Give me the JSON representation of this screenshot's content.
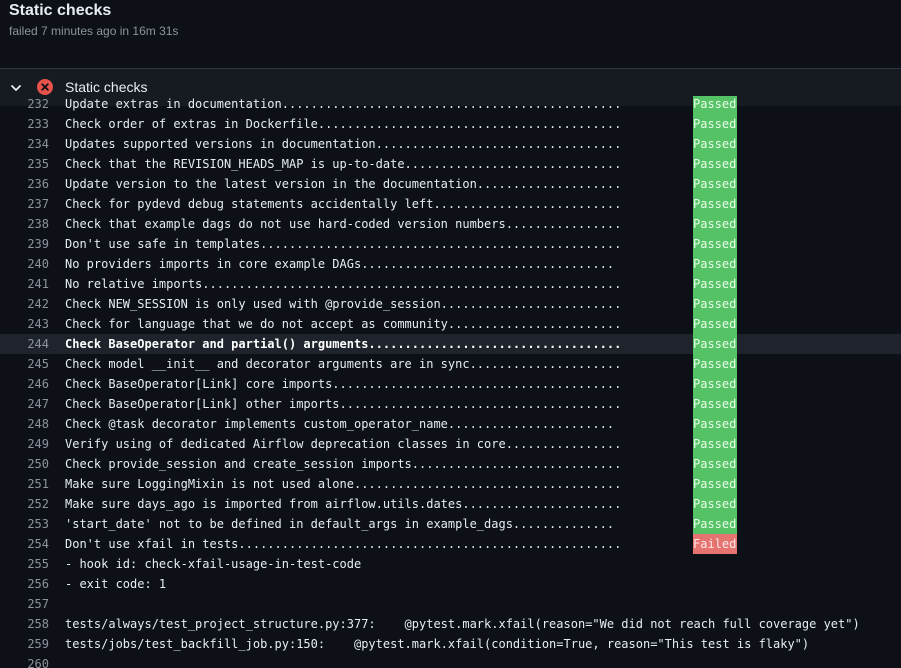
{
  "header": {
    "title": "Static checks",
    "subtitle": "failed 7 minutes ago in 16m 31s"
  },
  "step": {
    "title": "Static checks",
    "state_icon": "x-circle-icon",
    "toggle_icon": "chevron-down-icon",
    "status_color": "#e5534b"
  },
  "colors": {
    "passed": "#56c266",
    "failed": "#e5736f"
  },
  "log": [
    {
      "n": "232",
      "text": "Update extras in documentation...............................................",
      "status": "Passed"
    },
    {
      "n": "233",
      "text": "Check order of extras in Dockerfile..........................................",
      "status": "Passed"
    },
    {
      "n": "234",
      "text": "Updates supported versions in documentation..................................",
      "status": "Passed"
    },
    {
      "n": "235",
      "text": "Check that the REVISION_HEADS_MAP is up-to-date..............................",
      "status": "Passed"
    },
    {
      "n": "236",
      "text": "Update version to the latest version in the documentation....................",
      "status": "Passed"
    },
    {
      "n": "237",
      "text": "Check for pydevd debug statements accidentally left..........................",
      "status": "Passed"
    },
    {
      "n": "238",
      "text": "Check that example dags do not use hard-coded version numbers................",
      "status": "Passed"
    },
    {
      "n": "239",
      "text": "Don't use safe in templates..................................................",
      "status": "Passed"
    },
    {
      "n": "240",
      "text": "No providers imports in core example DAGs...................................",
      "status": "Passed"
    },
    {
      "n": "241",
      "text": "No relative imports..........................................................",
      "status": "Passed"
    },
    {
      "n": "242",
      "text": "Check NEW_SESSION is only used with @provide_session.........................",
      "status": "Passed"
    },
    {
      "n": "243",
      "text": "Check for language that we do not accept as community........................",
      "status": "Passed"
    },
    {
      "n": "244",
      "text": "Check BaseOperator and partial() arguments...................................",
      "status": "Passed",
      "highlight": true
    },
    {
      "n": "245",
      "text": "Check model __init__ and decorator arguments are in sync.....................",
      "status": "Passed"
    },
    {
      "n": "246",
      "text": "Check BaseOperator[Link] core imports........................................",
      "status": "Passed"
    },
    {
      "n": "247",
      "text": "Check BaseOperator[Link] other imports.......................................",
      "status": "Passed"
    },
    {
      "n": "248",
      "text": "Check @task decorator implements custom_operator_name.......................",
      "status": "Passed"
    },
    {
      "n": "249",
      "text": "Verify using of dedicated Airflow deprecation classes in core................",
      "status": "Passed"
    },
    {
      "n": "250",
      "text": "Check provide_session and create_session imports.............................",
      "status": "Passed"
    },
    {
      "n": "251",
      "text": "Make sure LoggingMixin is not used alone.....................................",
      "status": "Passed"
    },
    {
      "n": "252",
      "text": "Make sure days_ago is imported from airflow.utils.dates......................",
      "status": "Passed"
    },
    {
      "n": "253",
      "text": "'start_date' not to be defined in default_args in example_dags..............",
      "status": "Passed"
    },
    {
      "n": "254",
      "text": "Don't use xfail in tests.....................................................",
      "status": "Failed"
    },
    {
      "n": "255",
      "text": "- hook id: check-xfail-usage-in-test-code"
    },
    {
      "n": "256",
      "text": "- exit code: 1"
    },
    {
      "n": "257",
      "text": ""
    },
    {
      "n": "258",
      "text": "tests/always/test_project_structure.py:377:    @pytest.mark.xfail(reason=\"We did not reach full coverage yet\")"
    },
    {
      "n": "259",
      "text": "tests/jobs/test_backfill_job.py:150:    @pytest.mark.xfail(condition=True, reason=\"This test is flaky\")"
    },
    {
      "n": "260",
      "text": ""
    }
  ]
}
